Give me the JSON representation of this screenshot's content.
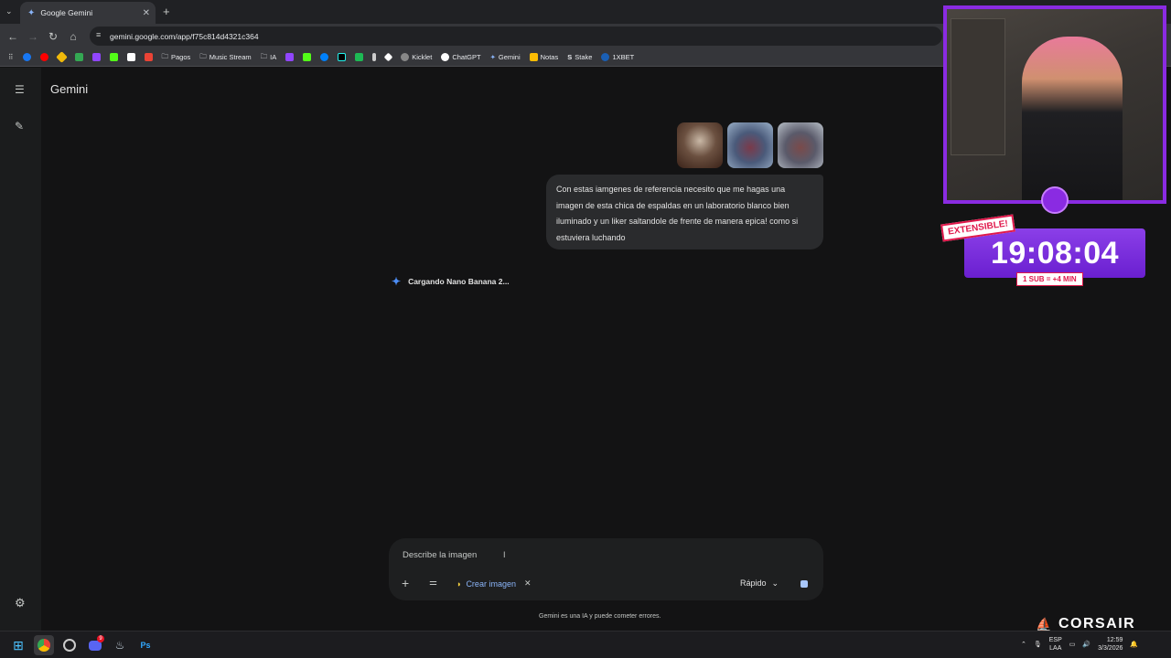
{
  "browser": {
    "tab_title": "Google Gemini",
    "tab_close": "✕",
    "new_tab": "+",
    "url": "gemini.google.com/app/f75c814d4321c364",
    "bookmarks": [
      "Pagos",
      "Music Stream",
      "IA",
      "Kicklet",
      "ChatGPT",
      "Gemini",
      "Notas",
      "Stake",
      "1XBET"
    ]
  },
  "app": {
    "name": "Gemini",
    "user_message": "Con estas iamgenes de referencia necesito que me hagas una imagen de esta chica de espaldas en un laboratorio blanco bien iluminado y un liker saltandole de frente de manera epica! como si estuviera luchando",
    "loading_text": "Cargando Nano Banana 2...",
    "prompt_placeholder": "Describe la imagen",
    "tool_chip": "Crear imagen",
    "chip_remove": "✕",
    "model_label": "Rápido",
    "disclaimer": "Gemini es una IA y puede cometer errores."
  },
  "stream_overlay": {
    "badge": "EXTENSIBLE!",
    "timer": "19:08:04",
    "sub_rule": "1 SUB = +4 MIN",
    "sponsor": "CORSAIR"
  },
  "taskbar": {
    "lang_top": "ESP",
    "lang_bottom": "LAA",
    "time": "12:59",
    "date": "3/3/2026",
    "discord_badge": "9",
    "ps_label": "Ps"
  },
  "colors": {
    "accent": "#8ab4f8",
    "purple": "#8a2be2",
    "bubble": "#2a2b2d"
  }
}
